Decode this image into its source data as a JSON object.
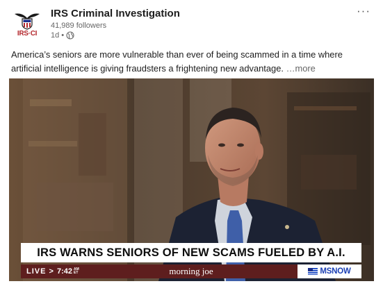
{
  "post": {
    "author": {
      "name": "IRS Criminal Investigation",
      "followers": "41,989 followers",
      "age": "1d",
      "separator": "•",
      "logo_text": "IRS·CI",
      "visibility_icon": "globe-icon"
    },
    "menu_icon": "more-horizontal-icon",
    "menu_label": "···",
    "text": "America’s seniors are more vulnerable than ever of being scammed in a time where artificial intelligence is giving fraudsters a frightening new advantage.",
    "see_more": "…more",
    "media": {
      "headline": "IRS WARNS SENIORS OF NEW SCAMS FUELED BY A.I.",
      "live_label": "LIVE",
      "live_arrow": ">",
      "time": "7:42",
      "time_zone_top": "AM",
      "time_zone_bottom": "ET",
      "show": "morning joe",
      "network": "MSNOW"
    }
  },
  "colors": {
    "ticker_bg": "#5e1e1e",
    "network_blue": "#1b3fb4",
    "logo_red": "#b3262b"
  }
}
